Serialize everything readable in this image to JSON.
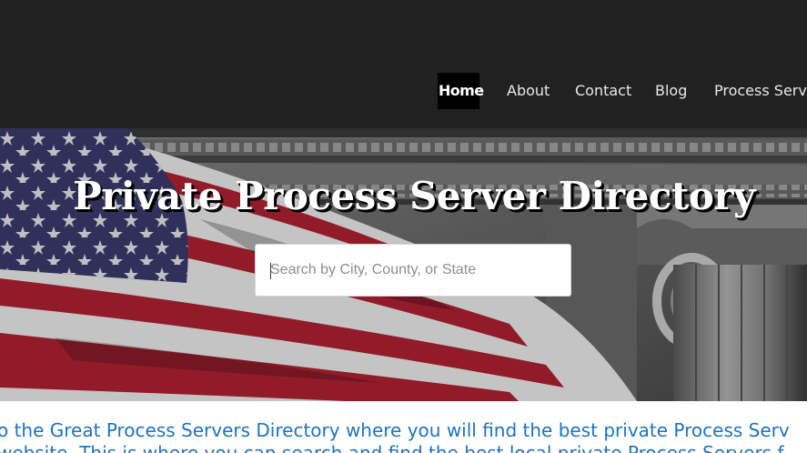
{
  "nav": {
    "items": [
      {
        "label": "Home",
        "active": true
      },
      {
        "label": "About"
      },
      {
        "label": "Contact"
      },
      {
        "label": "Blog"
      },
      {
        "label": "Process Servic"
      }
    ]
  },
  "hero": {
    "title": "Private Process Server Directory",
    "search_placeholder": "Search by City, County, or State"
  },
  "intro": {
    "line1": "o the Great Process Servers Directory where you will find the best private Process Serv",
    "line2": "website. This is where you can search and find the best local private Process Servers f"
  },
  "colors": {
    "header_bg": "#212121",
    "link_blue": "#1e73be",
    "flag_red": "#b22234",
    "flag_blue": "#3c3b6e"
  }
}
